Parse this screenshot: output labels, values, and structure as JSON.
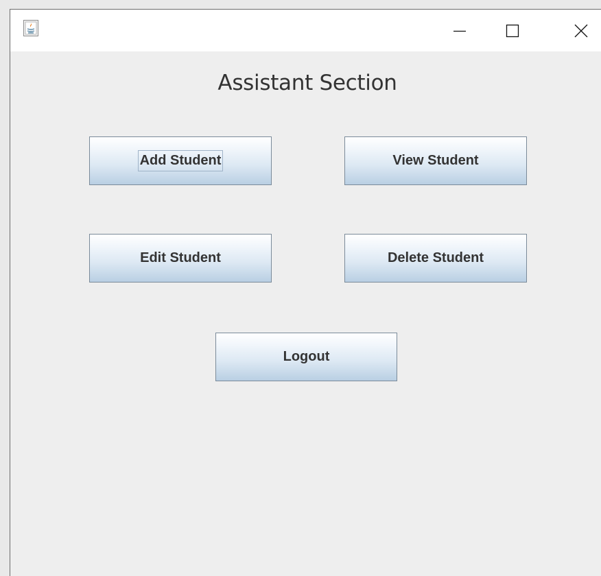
{
  "window": {
    "title": "",
    "controls": {
      "minimize_icon": "minimize-icon",
      "maximize_icon": "maximize-icon",
      "close_icon": "close-icon"
    },
    "app_icon": "java-app-icon"
  },
  "main": {
    "heading": "Assistant Section",
    "buttons": {
      "add_student": "Add Student",
      "view_student": "View Student",
      "edit_student": "Edit Student",
      "delete_student": "Delete Student",
      "logout": "Logout"
    },
    "focused_button": "Add Student"
  },
  "colors": {
    "content_background": "#eeeeee",
    "titlebar_background": "#ffffff",
    "button_border": "#7a8a99",
    "button_gradient_bottom": "#b9cfe3",
    "text": "#333333"
  }
}
